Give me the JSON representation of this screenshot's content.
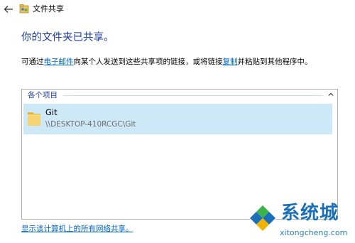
{
  "window": {
    "title": "文件共享"
  },
  "heading": "你的文件夹已共享。",
  "description": {
    "part1": "可通过",
    "email_link": "电子邮件",
    "part2": "向某个人发送到这些共享项的链接，或将链接",
    "copy_link": "复制",
    "part3": "并粘贴到其他程序中。"
  },
  "list": {
    "group_label": "各个项目",
    "items": [
      {
        "name": "Git",
        "path": "\\\\DESKTOP-410RCGC\\Git"
      }
    ]
  },
  "bottom_link": "显示该计算机上的所有网络共享。",
  "watermark": {
    "brand": "系统城",
    "url": "xitongcheng.com"
  },
  "colors": {
    "heading": "#1f3f9e",
    "link": "#0066cc",
    "selection": "#cde8f7",
    "folder": "#f2c94c"
  }
}
